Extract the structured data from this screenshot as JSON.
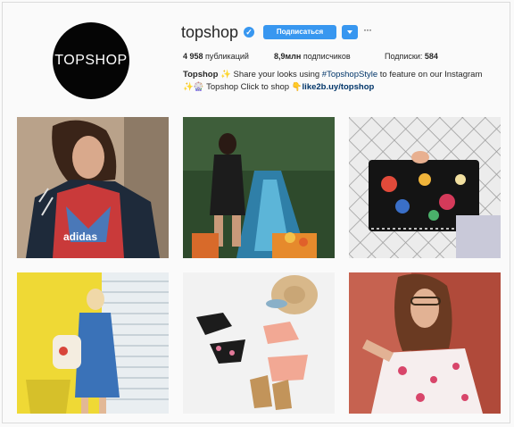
{
  "profile": {
    "avatar_text": "TOPSHOP",
    "username": "topshop",
    "verified_glyph": "✓",
    "follow_label": "Подписаться",
    "more_glyph": "···",
    "stats": {
      "posts_count": "4 958",
      "posts_label": "публикаций",
      "followers_count": "8,9млн",
      "followers_label": "подписчиков",
      "following_label": "Подписки:",
      "following_count": "584"
    },
    "bio": {
      "name": "Topshop",
      "line1_a": " ✨ Share your looks using ",
      "hashtag": "#TopshopStyle",
      "line1_b": " to feature on our Instagram",
      "line2_a": "✨🎡 Topshop Click to shop 👇",
      "link": "like2b.uy/topshop"
    }
  },
  "colors": {
    "accent": "#3897f0",
    "link": "#003569",
    "background": "#fafafa"
  },
  "posts": [
    {
      "name": "post-adidas-model"
    },
    {
      "name": "post-fountain-garden"
    },
    {
      "name": "post-embroidered-clutch"
    },
    {
      "name": "post-yellow-wall-backpack"
    },
    {
      "name": "post-swimwear-flatlay"
    },
    {
      "name": "post-floral-offshoulder"
    }
  ]
}
